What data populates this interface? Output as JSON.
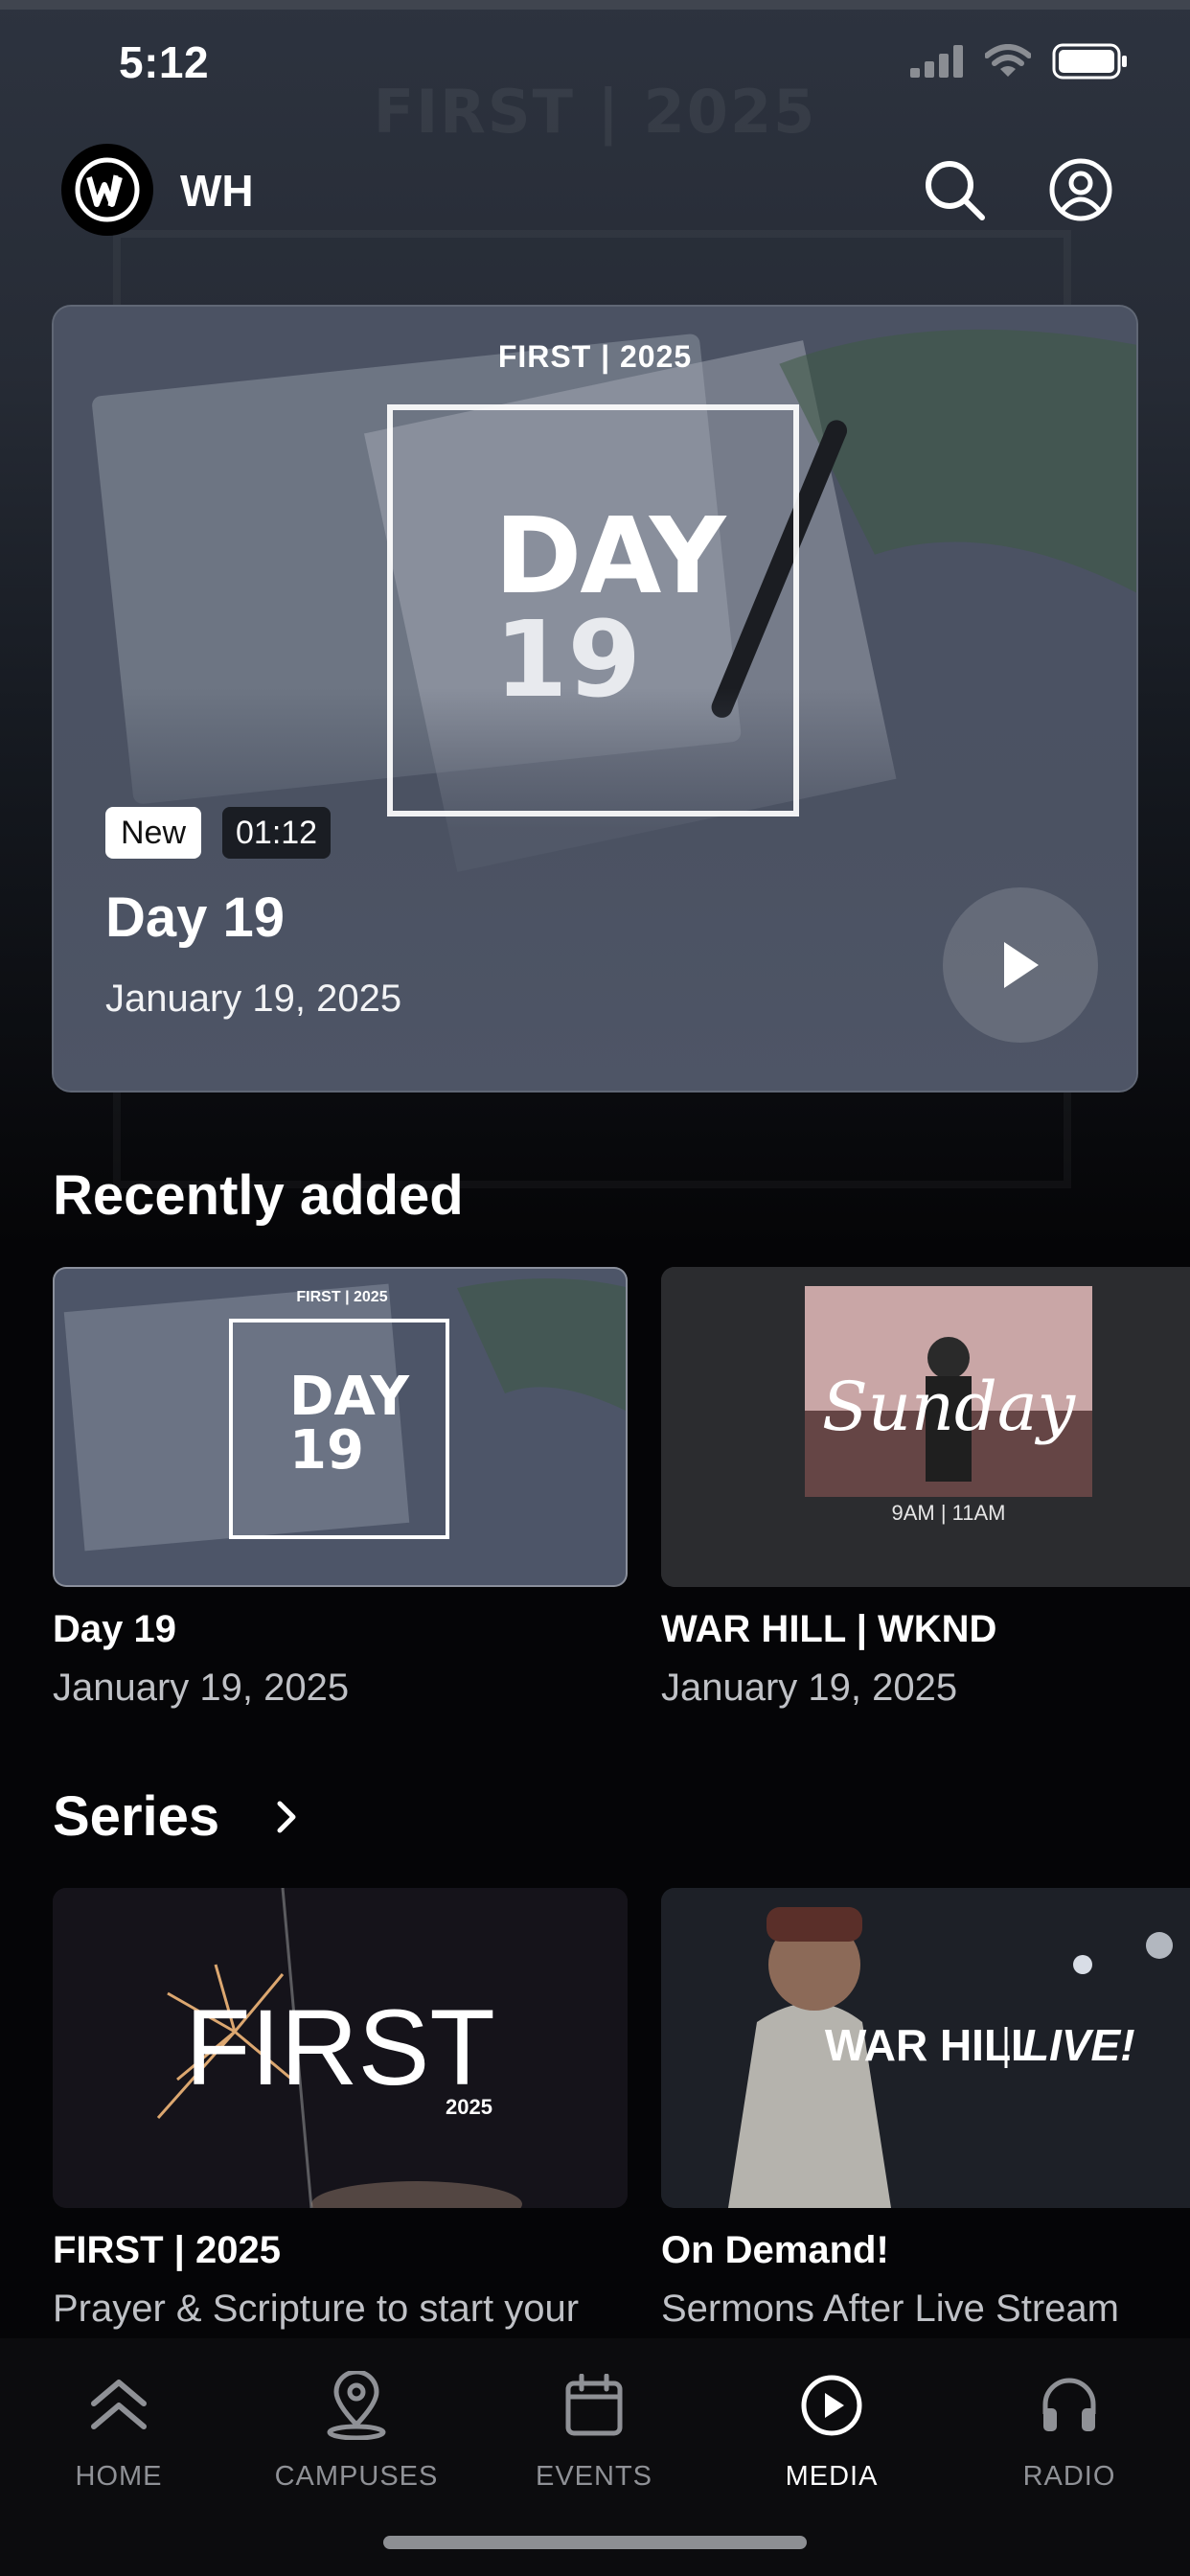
{
  "status_bar": {
    "time": "5:12"
  },
  "background_watermark": "FIRST | 2025",
  "header": {
    "brand": "WH"
  },
  "hero": {
    "tagline": "FIRST | 2025",
    "art_word": "DAY",
    "art_number": "19",
    "badge_new": "New",
    "duration": "01:12",
    "title": "Day 19",
    "date": "January 19, 2025"
  },
  "recently_added": {
    "title": "Recently added",
    "items": [
      {
        "title": "Day 19",
        "date": "January 19, 2025",
        "art_tagline": "FIRST | 2025",
        "art_word": "DAY",
        "art_number": "19"
      },
      {
        "title": "WAR HILL | WKND",
        "date": "January 19, 2025",
        "art_word": "Sunday",
        "art_times": "9AM  |  11AM"
      }
    ]
  },
  "series": {
    "title": "Series",
    "items": [
      {
        "title": "FIRST | 2025",
        "subtitle": "Prayer & Scripture to start your",
        "art_word": "FIRST",
        "art_year": "2025"
      },
      {
        "title": "On Demand!",
        "subtitle": "Sermons After Live Stream",
        "art_left": "WAR HILL",
        "art_right": "LIVE!"
      }
    ]
  },
  "tabs": [
    {
      "label": "HOME",
      "icon": "home-chevrons-icon"
    },
    {
      "label": "CAMPUSES",
      "icon": "map-pin-icon"
    },
    {
      "label": "EVENTS",
      "icon": "calendar-icon"
    },
    {
      "label": "MEDIA",
      "icon": "play-circle-icon",
      "active": true
    },
    {
      "label": "RADIO",
      "icon": "headphones-icon"
    }
  ],
  "colors": {
    "background": "#050507",
    "hero_card": "#4e5566",
    "inactive_tab": "#8f9196",
    "active_tab": "#ffffff"
  }
}
